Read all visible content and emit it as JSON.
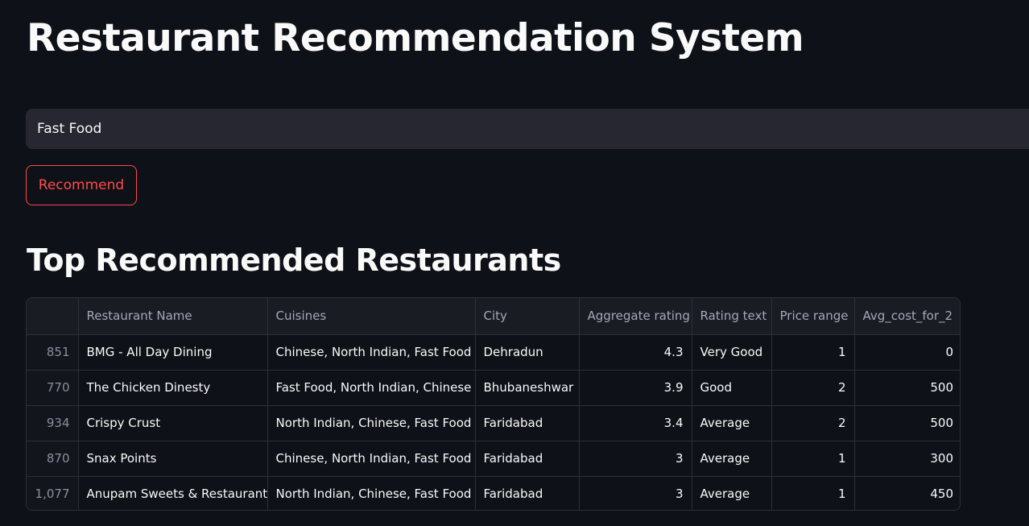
{
  "page_title": "Restaurant Recommendation System",
  "search": {
    "value": "Fast Food"
  },
  "recommend_button": "Recommend",
  "section_title": "Top Recommended Restaurants",
  "colors": {
    "background": "#0e1117",
    "accent": "#ff4b4b",
    "input_background": "#262730"
  },
  "table": {
    "columns": [
      "",
      "Restaurant Name",
      "Cuisines",
      "City",
      "Aggregate rating",
      "Rating text",
      "Price range",
      "Avg_cost_for_2"
    ],
    "rows": [
      {
        "index": "851",
        "name": "BMG - All Day Dining",
        "cuisines": "Chinese, North Indian, Fast Food",
        "city": "Dehradun",
        "rating": "4.3",
        "rating_text": "Very Good",
        "price_range": "1",
        "avg_cost": "0"
      },
      {
        "index": "770",
        "name": "The Chicken Dinesty",
        "cuisines": "Fast Food, North Indian, Chinese",
        "city": "Bhubaneshwar",
        "rating": "3.9",
        "rating_text": "Good",
        "price_range": "2",
        "avg_cost": "500"
      },
      {
        "index": "934",
        "name": "Crispy Crust",
        "cuisines": "North Indian, Chinese, Fast Food",
        "city": "Faridabad",
        "rating": "3.4",
        "rating_text": "Average",
        "price_range": "2",
        "avg_cost": "500"
      },
      {
        "index": "870",
        "name": "Snax Points",
        "cuisines": "Chinese, North Indian, Fast Food",
        "city": "Faridabad",
        "rating": "3",
        "rating_text": "Average",
        "price_range": "1",
        "avg_cost": "300"
      },
      {
        "index": "1,077",
        "name": "Anupam Sweets & Restaurant",
        "cuisines": "North Indian, Chinese, Fast Food",
        "city": "Faridabad",
        "rating": "3",
        "rating_text": "Average",
        "price_range": "1",
        "avg_cost": "450"
      }
    ]
  }
}
